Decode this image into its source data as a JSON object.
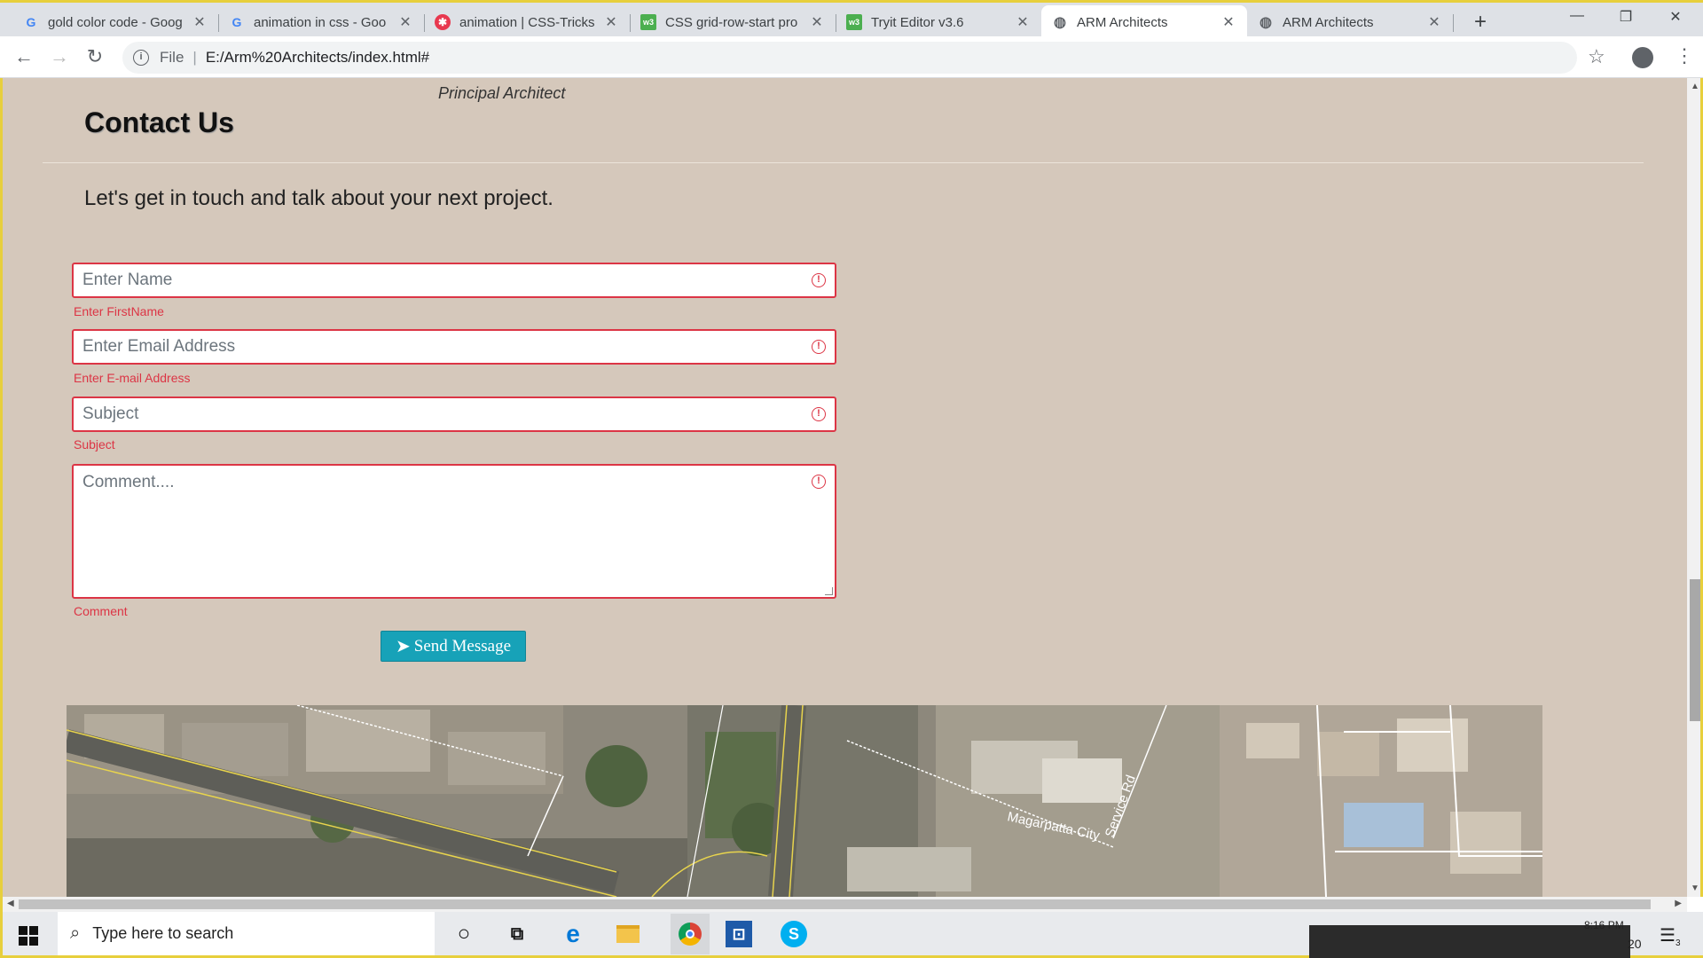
{
  "browser": {
    "tabs": [
      {
        "title": "gold color code - Goog",
        "icon": "google-icon"
      },
      {
        "title": "animation in css - Goo",
        "icon": "google-icon"
      },
      {
        "title": "animation | CSS-Tricks",
        "icon": "css-tricks-icon"
      },
      {
        "title": "CSS grid-row-start pro",
        "icon": "w3schools-icon"
      },
      {
        "title": "Tryit Editor v3.6",
        "icon": "w3schools-icon"
      },
      {
        "title": "ARM Architects",
        "icon": "globe-icon",
        "active": true
      },
      {
        "title": "ARM Architects",
        "icon": "globe-icon"
      }
    ],
    "address": {
      "scheme_label": "File",
      "url": "E:/Arm%20Architects/index.html#"
    }
  },
  "page": {
    "principal_caption": "Principal Architect",
    "contact_title": "Contact Us",
    "lead_text": "Let's get in touch and talk about your next project.",
    "form": {
      "name_placeholder": "Enter Name",
      "name_error": "Enter FirstName",
      "email_placeholder": "Enter Email Address",
      "email_error": "Enter E-mail Address",
      "subject_placeholder": "Subject",
      "subject_error": "Subject",
      "comment_placeholder": "Comment....",
      "comment_error": "Comment",
      "send_label": "Send Message"
    },
    "map_labels": {
      "road_1": "Magarpatta City",
      "road_2": "Service Rd"
    }
  },
  "taskbar": {
    "search_placeholder": "Type here to search",
    "clock_time": "8:16 PM",
    "clock_date_fragment": "20",
    "notification_count": "3"
  },
  "colors": {
    "page_background": "#d5c8bb",
    "error_red": "#dc3545",
    "button_teal": "#17a2b8",
    "window_frame": "#e7cf3c"
  }
}
